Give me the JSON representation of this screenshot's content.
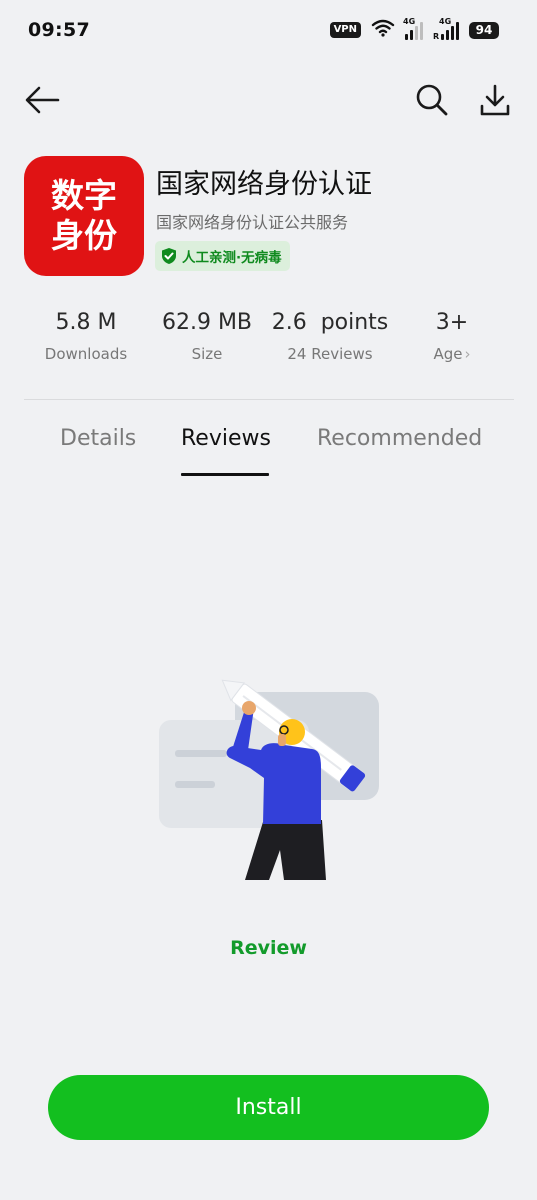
{
  "status_bar": {
    "time": "09:57",
    "vpn": "VPN",
    "net1": "4G",
    "net2": "4G",
    "roaming": "R",
    "battery": "94"
  },
  "nav": {
    "back_icon": "arrow-left-icon",
    "search_icon": "search-icon",
    "download_icon": "download-icon"
  },
  "app": {
    "icon_line1": "数字",
    "icon_line2": "身份",
    "icon_color": "#e01314",
    "name": "国家网络身份认证",
    "subtitle": "国家网络身份认证公共服务",
    "verified_label": "人工亲测·无病毒",
    "verified_color": "#0f8a1e"
  },
  "stats": [
    {
      "value": "5.8 M",
      "label": "Downloads"
    },
    {
      "value": "62.9 MB",
      "label": "Size"
    },
    {
      "value": "2.6  points",
      "label": "24 Reviews"
    },
    {
      "value": "3+",
      "label": "Age"
    }
  ],
  "tabs": [
    {
      "label": "Details",
      "active": false
    },
    {
      "label": "Reviews",
      "active": true
    },
    {
      "label": "Recommended",
      "active": false
    }
  ],
  "empty_state": {
    "illustration": "person-holding-pencil-illustration",
    "link_label": "Review",
    "link_color": "#139b2b"
  },
  "install": {
    "label": "Install",
    "color": "#13bf1f"
  }
}
